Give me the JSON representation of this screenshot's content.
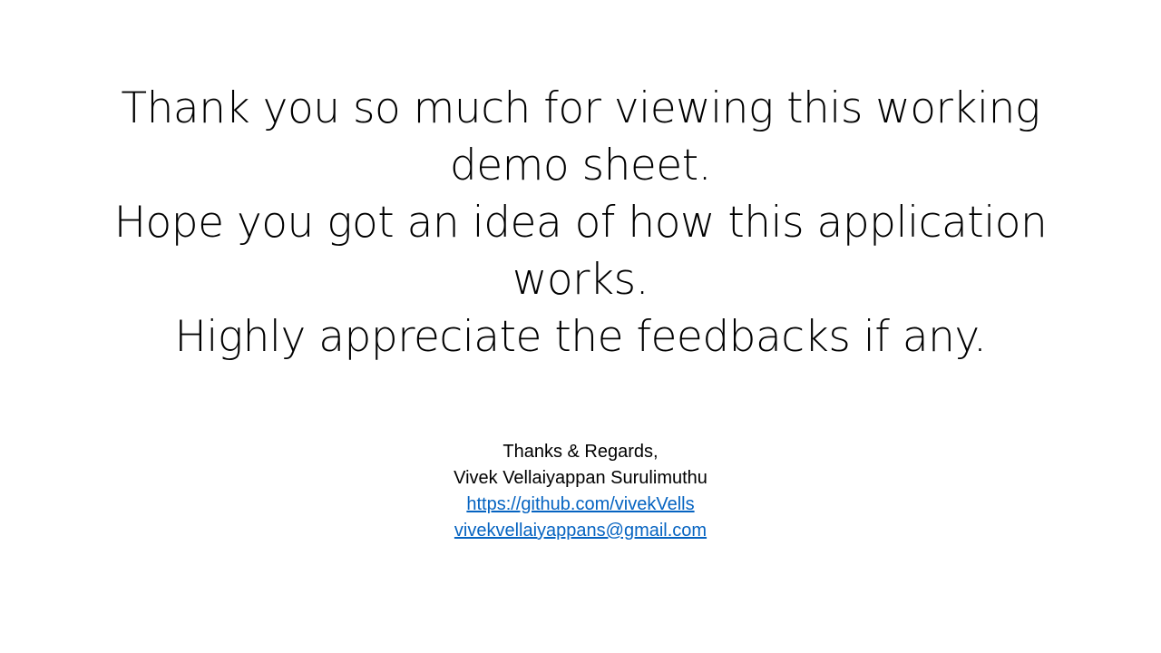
{
  "slide": {
    "message_lines": [
      "Thank you so much for viewing this working",
      "demo sheet.",
      "Hope you got an idea of how this application",
      "works.",
      "Highly appreciate the feedbacks if any."
    ],
    "closing": "Thanks & Regards,",
    "author": "Vivek Vellaiyappan Surulimuthu",
    "github_link": "https://github.com/vivekVells",
    "email_link": "vivekvellaiyappans@gmail.com",
    "link_color": "#0563C1"
  }
}
